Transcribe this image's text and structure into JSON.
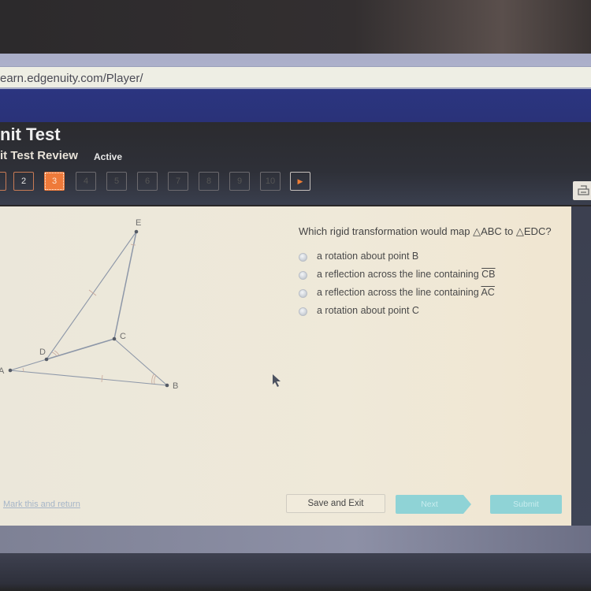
{
  "browser": {
    "url": "earn.edgenuity.com/Player/"
  },
  "header": {
    "title": "nit Test",
    "subtitle": "it Test Review",
    "status": "Active"
  },
  "question_nav": {
    "items": [
      {
        "label": "",
        "state": "done"
      },
      {
        "label": "2",
        "state": "done"
      },
      {
        "label": "3",
        "state": "current"
      },
      {
        "label": "4",
        "state": "locked"
      },
      {
        "label": "5",
        "state": "locked"
      },
      {
        "label": "6",
        "state": "locked"
      },
      {
        "label": "7",
        "state": "locked"
      },
      {
        "label": "8",
        "state": "locked"
      },
      {
        "label": "9",
        "state": "locked"
      },
      {
        "label": "10",
        "state": "locked"
      }
    ],
    "next_icon": "▶"
  },
  "figure": {
    "points": {
      "A": "A",
      "B": "B",
      "C": "C",
      "D": "D",
      "E": "E"
    }
  },
  "question": {
    "text": "Which rigid transformation would map △ABC to △EDC?",
    "options": [
      {
        "text": "a rotation about point B",
        "segment": ""
      },
      {
        "text": "a reflection across the line containing ",
        "segment": "CB"
      },
      {
        "text": "a reflection across the line containing ",
        "segment": "AC"
      },
      {
        "text": "a rotation about point C",
        "segment": ""
      }
    ]
  },
  "footer": {
    "mark_link": "Mark this and return",
    "save_exit": "Save and Exit",
    "next": "Next",
    "submit": "Submit"
  },
  "colors": {
    "accent_orange": "#ef7a3a",
    "nav_blue": "#2b3580",
    "button_teal": "#8fd3d6"
  }
}
